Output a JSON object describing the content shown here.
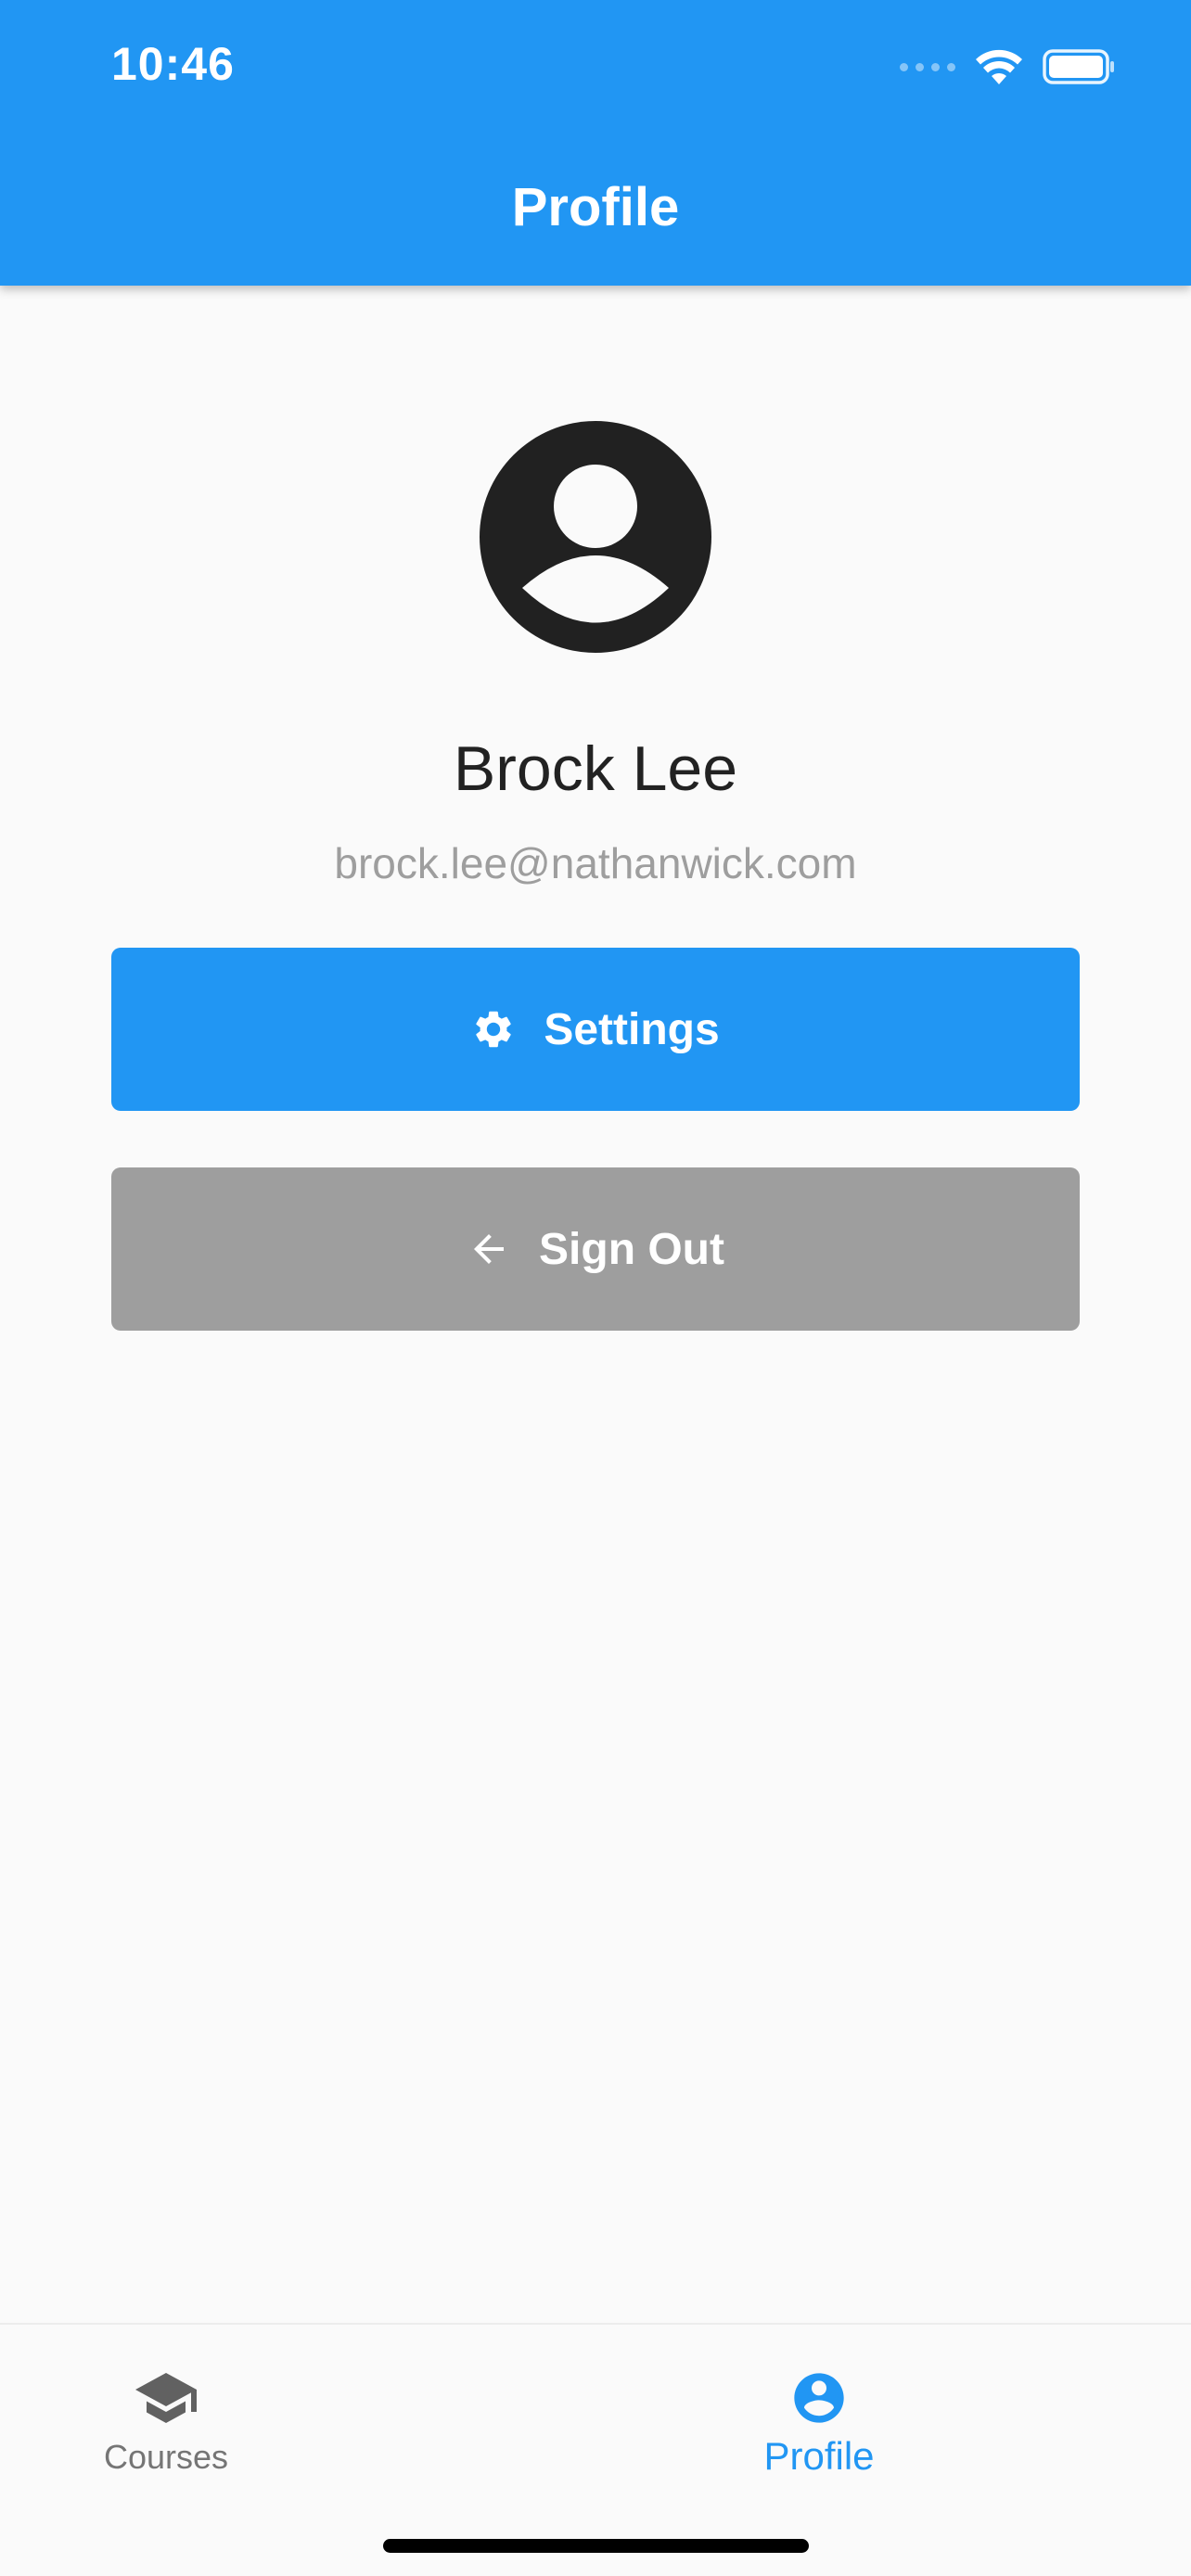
{
  "status_bar": {
    "time": "10:46"
  },
  "header": {
    "title": "Profile"
  },
  "profile": {
    "name": "Brock Lee",
    "email": "brock.lee@nathanwick.com"
  },
  "actions": {
    "settings_label": "Settings",
    "signout_label": "Sign Out"
  },
  "bottom_nav": {
    "items": [
      {
        "label": "Courses",
        "icon": "graduation-cap-icon",
        "active": false
      },
      {
        "label": "Profile",
        "icon": "account-circle-icon",
        "active": true
      }
    ]
  },
  "colors": {
    "primary": "#2196f3",
    "secondary_button": "#9e9e9e",
    "background": "#fafafa",
    "text_dark": "#222222",
    "text_muted": "#9e9e9e"
  }
}
